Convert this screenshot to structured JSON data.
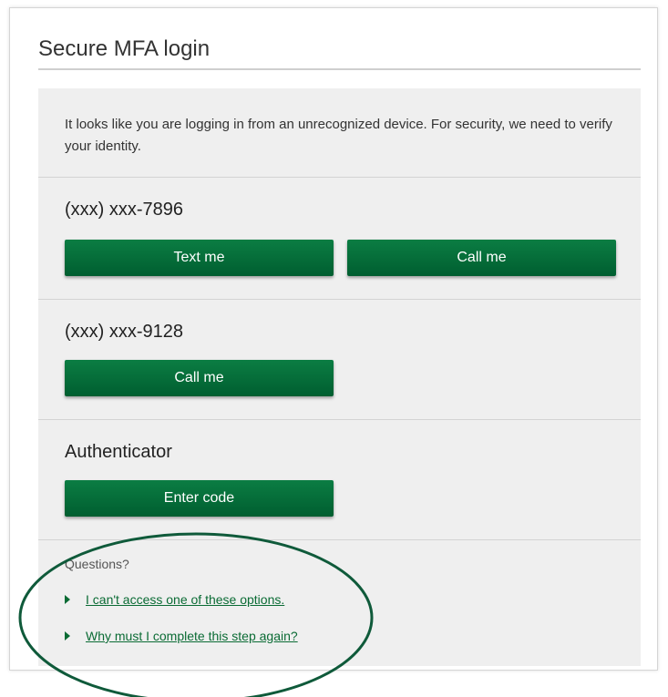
{
  "header": {
    "title": "Secure MFA login"
  },
  "intro": {
    "text": "It looks like you are logging in from an unrecognized device. For security, we need to verify your identity."
  },
  "options": [
    {
      "label": "(xxx) xxx-7896",
      "buttons": [
        "Text me",
        "Call me"
      ]
    },
    {
      "label": "(xxx) xxx-9128",
      "buttons": [
        "Call me"
      ]
    },
    {
      "label": "Authenticator",
      "buttons": [
        "Enter code"
      ]
    }
  ],
  "questions": {
    "label": "Questions?",
    "links": [
      "I can't access one of these options.",
      "Why must I complete this step again?"
    ]
  },
  "colors": {
    "button_green": "#006b38",
    "link_green": "#0a6b34",
    "annotation_ellipse": "#0f5a3a"
  },
  "icons": {
    "link_bullet": "triangle-right-icon"
  }
}
